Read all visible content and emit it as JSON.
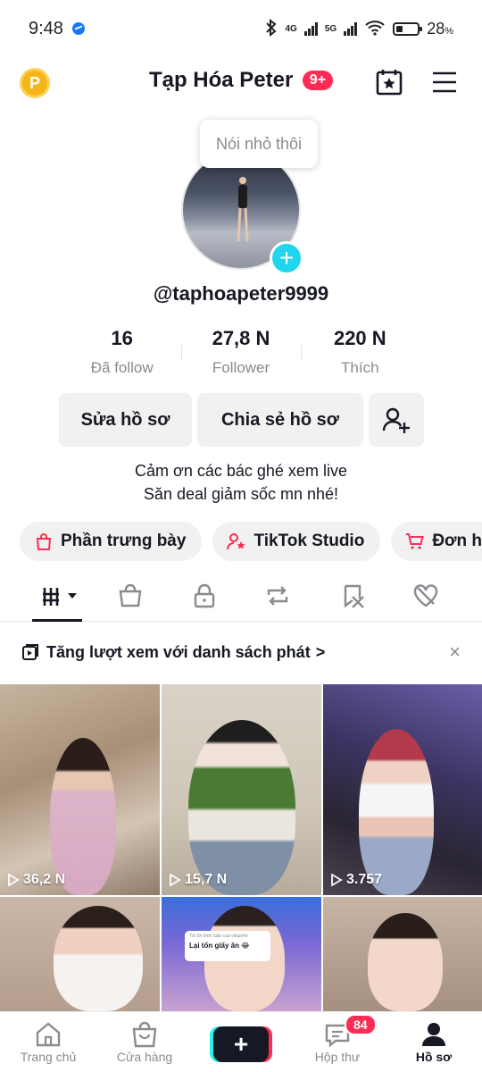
{
  "status_bar": {
    "time": "9:48",
    "net1": "4G",
    "net2": "5G",
    "battery": "28"
  },
  "header": {
    "title": "Tạp Hóa Peter",
    "badge": "9+",
    "coin_label": "P"
  },
  "profile": {
    "note": "Nói nhỏ thôi",
    "username": "@taphoapeter9999",
    "stats": [
      {
        "value": "16",
        "label": "Đã follow"
      },
      {
        "value": "27,8 N",
        "label": "Follower"
      },
      {
        "value": "220 N",
        "label": "Thích"
      }
    ],
    "buttons": {
      "edit": "Sửa hồ sơ",
      "share": "Chia sẻ hồ sơ"
    },
    "bio_line1": "Cảm ơn các bác ghé xem live",
    "bio_line2": "Săn deal giảm sốc mn nhé!"
  },
  "chips": [
    {
      "label": "Phần trưng bày",
      "icon": "bag-icon"
    },
    {
      "label": "TikTok Studio",
      "icon": "studio-icon"
    },
    {
      "label": "Đơn h",
      "icon": "cart-icon"
    }
  ],
  "playlist_banner": {
    "text": "Tăng lượt xem với danh sách phát",
    "chevron": ">",
    "close": "×"
  },
  "videos": [
    {
      "views": "36,2 N"
    },
    {
      "views": "15,7 N"
    },
    {
      "views": "3.757"
    },
    {
      "views": ""
    },
    {
      "views": "",
      "caption_title": "Trả lời bình luận của vitquerlo",
      "caption_text": "Lại tốn giấy ăn 😂"
    },
    {
      "views": ""
    }
  ],
  "bottom_nav": {
    "home": "Trang chủ",
    "shop": "Cửa hàng",
    "create": "+",
    "inbox": "Hộp thư",
    "inbox_badge": "84",
    "profile": "Hồ sơ"
  },
  "colors": {
    "accent": "#fe2c55",
    "teal": "#20d5ec",
    "text": "#161823",
    "muted": "#8a8b91"
  }
}
